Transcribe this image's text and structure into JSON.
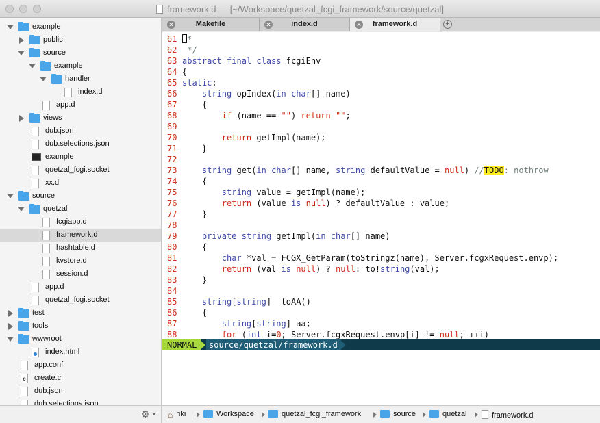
{
  "window": {
    "title": "framework.d — [~/Workspace/quetzal_fcgi_framework/source/quetzal]"
  },
  "sidebar": {
    "items": [
      {
        "label": "example",
        "kind": "folder",
        "depth": 0,
        "state": "open"
      },
      {
        "label": "public",
        "kind": "folder",
        "depth": 1,
        "state": "closed"
      },
      {
        "label": "source",
        "kind": "folder",
        "depth": 1,
        "state": "open"
      },
      {
        "label": "example",
        "kind": "folder",
        "depth": 2,
        "state": "open"
      },
      {
        "label": "handler",
        "kind": "folder",
        "depth": 3,
        "state": "open"
      },
      {
        "label": "index.d",
        "kind": "file",
        "depth": 4
      },
      {
        "label": "app.d",
        "kind": "file",
        "depth": 2
      },
      {
        "label": "views",
        "kind": "folder",
        "depth": 1,
        "state": "closed"
      },
      {
        "label": "dub.json",
        "kind": "file",
        "depth": 1
      },
      {
        "label": "dub.selections.json",
        "kind": "file",
        "depth": 1
      },
      {
        "label": "example",
        "kind": "exec",
        "depth": 1
      },
      {
        "label": "quetzal_fcgi.socket",
        "kind": "file",
        "depth": 1
      },
      {
        "label": "xx.d",
        "kind": "file",
        "depth": 1
      },
      {
        "label": "source",
        "kind": "folder",
        "depth": 0,
        "state": "open"
      },
      {
        "label": "quetzal",
        "kind": "folder",
        "depth": 1,
        "state": "open"
      },
      {
        "label": "fcgiapp.d",
        "kind": "file",
        "depth": 2
      },
      {
        "label": "framework.d",
        "kind": "file",
        "depth": 2,
        "selected": true
      },
      {
        "label": "hashtable.d",
        "kind": "file",
        "depth": 2
      },
      {
        "label": "kvstore.d",
        "kind": "file",
        "depth": 2
      },
      {
        "label": "session.d",
        "kind": "file",
        "depth": 2
      },
      {
        "label": "app.d",
        "kind": "file",
        "depth": 1
      },
      {
        "label": "quetzal_fcgi.socket",
        "kind": "file",
        "depth": 1
      },
      {
        "label": "test",
        "kind": "folder",
        "depth": 0,
        "state": "closed"
      },
      {
        "label": "tools",
        "kind": "folder",
        "depth": 0,
        "state": "closed"
      },
      {
        "label": "wwwroot",
        "kind": "folder",
        "depth": 0,
        "state": "open"
      },
      {
        "label": "index.html",
        "kind": "html",
        "depth": 1
      },
      {
        "label": "app.conf",
        "kind": "file",
        "depth": 0
      },
      {
        "label": "create.c",
        "kind": "c",
        "depth": 0
      },
      {
        "label": "dub.json",
        "kind": "file",
        "depth": 0
      },
      {
        "label": "dub.selections.json",
        "kind": "file",
        "depth": 0
      }
    ]
  },
  "tabs": [
    {
      "label": "Makefile",
      "active": false
    },
    {
      "label": "index.d",
      "active": false
    },
    {
      "label": "framework.d",
      "active": true
    }
  ],
  "editor": {
    "lines": [
      {
        "n": "61",
        "code": [
          [
            "cursor",
            ""
          ],
          [
            "cmt",
            "*"
          ]
        ]
      },
      {
        "n": "62",
        "code": [
          [
            "cmt",
            " */"
          ]
        ]
      },
      {
        "n": "63",
        "code": [
          [
            "kw",
            "abstract final class"
          ],
          [
            "",
            " fcgiEnv"
          ]
        ]
      },
      {
        "n": "64",
        "code": [
          [
            "",
            "{"
          ]
        ]
      },
      {
        "n": "65",
        "code": [
          [
            "kw",
            "static"
          ],
          [
            "",
            ":"
          ]
        ]
      },
      {
        "n": "66",
        "code": [
          [
            "",
            "    "
          ],
          [
            "ty",
            "string"
          ],
          [
            "",
            " opIndex("
          ],
          [
            "kw",
            "in"
          ],
          [
            "",
            " "
          ],
          [
            "ty",
            "char"
          ],
          [
            "",
            "[] name)"
          ]
        ]
      },
      {
        "n": "67",
        "code": [
          [
            "",
            "    {"
          ]
        ]
      },
      {
        "n": "68",
        "code": [
          [
            "",
            "        "
          ],
          [
            "str",
            "if"
          ],
          [
            "",
            " (name == "
          ],
          [
            "str",
            "\"\""
          ],
          [
            "",
            ") "
          ],
          [
            "str",
            "return"
          ],
          [
            "",
            " "
          ],
          [
            "str",
            "\"\""
          ],
          [
            "",
            ";"
          ]
        ]
      },
      {
        "n": "69",
        "code": [
          [
            "",
            ""
          ]
        ]
      },
      {
        "n": "70",
        "code": [
          [
            "",
            "        "
          ],
          [
            "str",
            "return"
          ],
          [
            "",
            " getImpl(name);"
          ]
        ]
      },
      {
        "n": "71",
        "code": [
          [
            "",
            "    }"
          ]
        ]
      },
      {
        "n": "72",
        "code": [
          [
            "",
            ""
          ]
        ]
      },
      {
        "n": "73",
        "code": [
          [
            "",
            "    "
          ],
          [
            "ty",
            "string"
          ],
          [
            "",
            " get("
          ],
          [
            "kw",
            "in"
          ],
          [
            "",
            " "
          ],
          [
            "ty",
            "char"
          ],
          [
            "",
            "[] name, "
          ],
          [
            "ty",
            "string"
          ],
          [
            "",
            " defaultValue = "
          ],
          [
            "str",
            "null"
          ],
          [
            "",
            ") "
          ],
          [
            "cmt",
            "//"
          ],
          [
            "todo",
            "TODO"
          ],
          [
            "cmt",
            ": nothrow"
          ]
        ]
      },
      {
        "n": "74",
        "code": [
          [
            "",
            "    {"
          ]
        ]
      },
      {
        "n": "75",
        "code": [
          [
            "",
            "        "
          ],
          [
            "ty",
            "string"
          ],
          [
            "",
            " value = getImpl(name);"
          ]
        ]
      },
      {
        "n": "76",
        "code": [
          [
            "",
            "        "
          ],
          [
            "str",
            "return"
          ],
          [
            "",
            " (value "
          ],
          [
            "kw",
            "is"
          ],
          [
            "",
            " "
          ],
          [
            "str",
            "null"
          ],
          [
            "",
            ") ? defaultValue : value;"
          ]
        ]
      },
      {
        "n": "77",
        "code": [
          [
            "",
            "    }"
          ]
        ]
      },
      {
        "n": "78",
        "code": [
          [
            "",
            ""
          ]
        ]
      },
      {
        "n": "79",
        "code": [
          [
            "",
            "    "
          ],
          [
            "kw",
            "private"
          ],
          [
            "",
            " "
          ],
          [
            "ty",
            "string"
          ],
          [
            "",
            " getImpl("
          ],
          [
            "kw",
            "in"
          ],
          [
            "",
            " "
          ],
          [
            "ty",
            "char"
          ],
          [
            "",
            "[] name)"
          ]
        ]
      },
      {
        "n": "80",
        "code": [
          [
            "",
            "    {"
          ]
        ]
      },
      {
        "n": "81",
        "code": [
          [
            "",
            "        "
          ],
          [
            "ty",
            "char"
          ],
          [
            "",
            " *val = FCGX_GetParam(toStringz(name), Server.fcgxRequest.envp);"
          ]
        ]
      },
      {
        "n": "82",
        "code": [
          [
            "",
            "        "
          ],
          [
            "str",
            "return"
          ],
          [
            "",
            " (val "
          ],
          [
            "kw",
            "is"
          ],
          [
            "",
            " "
          ],
          [
            "str",
            "null"
          ],
          [
            "",
            ") ? "
          ],
          [
            "str",
            "null"
          ],
          [
            "",
            ": to!"
          ],
          [
            "ty",
            "string"
          ],
          [
            "",
            "(val);"
          ]
        ]
      },
      {
        "n": "83",
        "code": [
          [
            "",
            "    }"
          ]
        ]
      },
      {
        "n": "84",
        "code": [
          [
            "",
            ""
          ]
        ]
      },
      {
        "n": "85",
        "code": [
          [
            "",
            "    "
          ],
          [
            "ty",
            "string"
          ],
          [
            "",
            "["
          ],
          [
            "ty",
            "string"
          ],
          [
            "",
            "]  toAA()"
          ]
        ]
      },
      {
        "n": "86",
        "code": [
          [
            "",
            "    {"
          ]
        ]
      },
      {
        "n": "87",
        "code": [
          [
            "",
            "        "
          ],
          [
            "ty",
            "string"
          ],
          [
            "",
            "["
          ],
          [
            "ty",
            "string"
          ],
          [
            "",
            "] aa;"
          ]
        ]
      },
      {
        "n": "88",
        "code": [
          [
            "",
            "        "
          ],
          [
            "str",
            "for"
          ],
          [
            "",
            " ("
          ],
          [
            "ty",
            "int"
          ],
          [
            "",
            " i="
          ],
          [
            "str",
            "0"
          ],
          [
            "",
            "; Server.fcgxRequest.envp[i] != "
          ],
          [
            "str",
            "null"
          ],
          [
            "",
            "; ++i)"
          ]
        ]
      }
    ]
  },
  "statusline": {
    "mode": "NORMAL",
    "path": "source/quetzal/framework.d"
  },
  "pathbar": {
    "crumbs": [
      {
        "label": "riki",
        "icon": "home-icon"
      },
      {
        "label": "Workspace",
        "icon": "folder-icon"
      },
      {
        "label": "quetzal_fcgi_framework",
        "icon": "folder-icon"
      },
      {
        "label": "source",
        "icon": "folder-icon"
      },
      {
        "label": "quetzal",
        "icon": "folder-icon"
      },
      {
        "label": "framework.d",
        "icon": "document-icon"
      }
    ]
  },
  "colors": {
    "folder": "#4aa5e8",
    "mode_bg": "#a6d83b",
    "status_bg": "#0f3a4a",
    "line_number": "#d12f1b",
    "keyword": "#3f49a6",
    "todo_highlight": "#ffec1f"
  }
}
